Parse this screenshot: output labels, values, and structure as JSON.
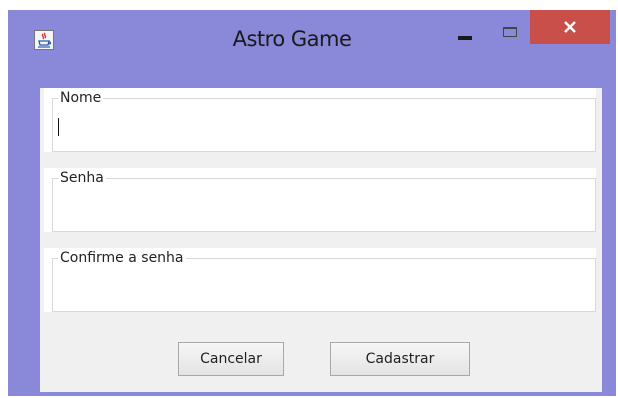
{
  "window": {
    "title": "Astro Game",
    "icons": {
      "app": "java-icon",
      "minimize": "minimize-icon",
      "maximize": "maximize-icon",
      "close": "close-icon"
    },
    "colors": {
      "frame": "#8a88d8",
      "close_button": "#c84f4a",
      "content_bg": "#f0f0f0"
    }
  },
  "form": {
    "fields": [
      {
        "label": "Nome",
        "value": ""
      },
      {
        "label": "Senha",
        "value": ""
      },
      {
        "label": "Confirme a senha",
        "value": ""
      }
    ],
    "buttons": {
      "cancel": "Cancelar",
      "submit": "Cadastrar"
    }
  }
}
